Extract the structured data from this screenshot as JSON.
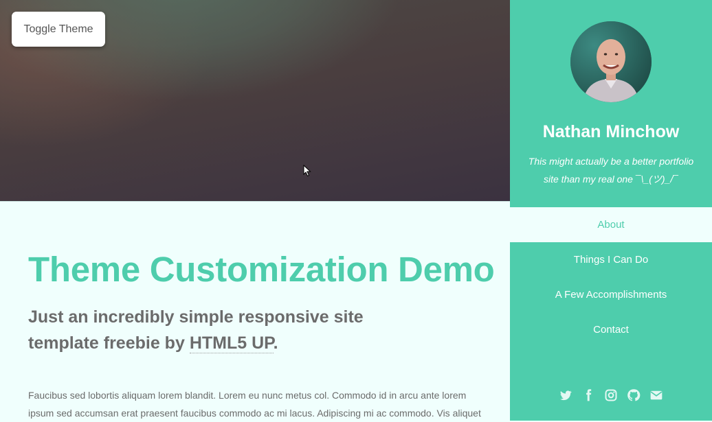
{
  "hero": {
    "toggle_label": "Toggle Theme"
  },
  "sidebar": {
    "name": "Nathan Minchow",
    "tagline_line1": "This might actually be a better portfolio",
    "tagline_line2": "site than my real one ¯\\_(ツ)_/¯",
    "avatar": "profile-photo",
    "nav": [
      {
        "label": "About",
        "active": true
      },
      {
        "label": "Things I Can Do",
        "active": false
      },
      {
        "label": "A Few Accomplishments",
        "active": false
      },
      {
        "label": "Contact",
        "active": false
      }
    ],
    "social_icons": [
      "twitter-icon",
      "facebook-icon",
      "instagram-icon",
      "github-icon",
      "email-icon"
    ]
  },
  "main": {
    "title": "Theme Customization Demo",
    "subtitle_prefix": "Just an incredibly simple responsive site template freebie by ",
    "subtitle_link": "HTML5 UP",
    "subtitle_suffix": ".",
    "body": "Faucibus sed lobortis aliquam lorem blandit. Lorem eu nunc metus col. Commodo id in arcu ante lorem ipsum sed accumsan erat praesent faucibus commodo ac mi lacus. Adipiscing mi ac commodo. Vis aliquet"
  },
  "colors": {
    "accent": "#4ecdac",
    "page_bg": "#f0fffd",
    "text": "#6b6b6b"
  }
}
